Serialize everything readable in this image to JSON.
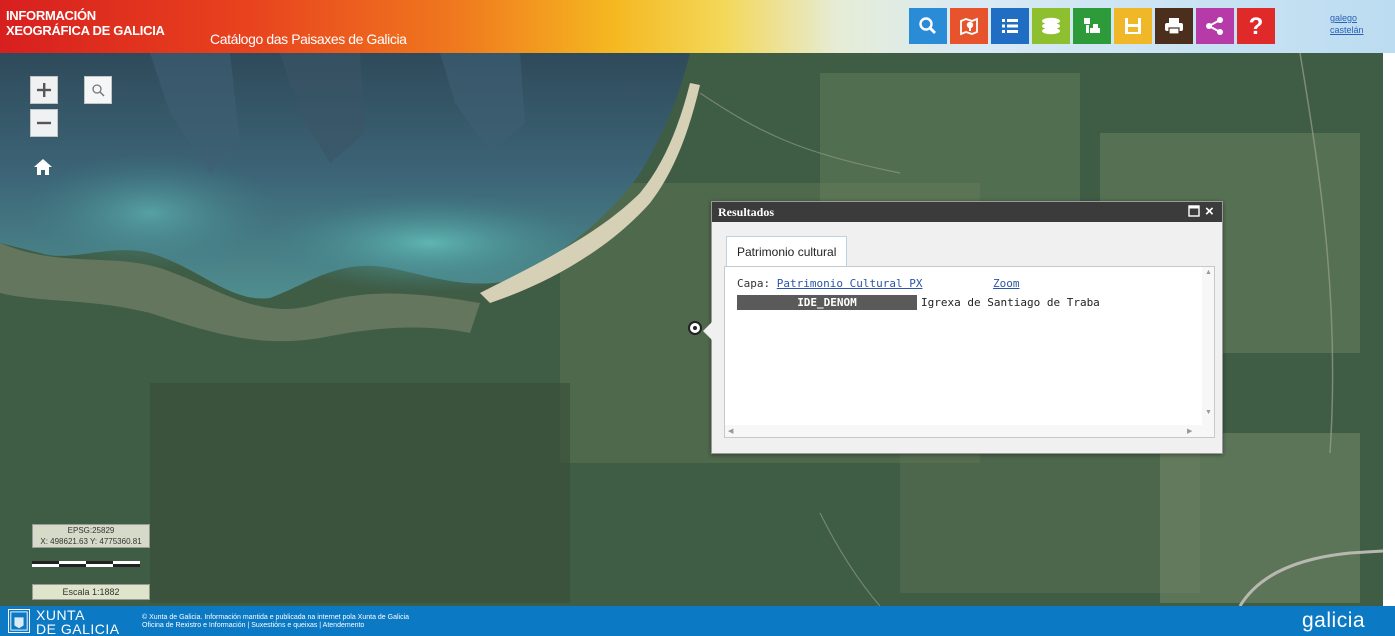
{
  "header": {
    "logo_line1": "INFORMACIÓN",
    "logo_line2": "XEOGRÁFICA DE GALICIA",
    "catalog_title": "Catálogo das Paisaxes de Galicia",
    "toolbar": [
      {
        "icon": "search-icon",
        "color": "#2a8bd6"
      },
      {
        "icon": "location-tool-icon",
        "color": "#e6532d"
      },
      {
        "icon": "list-icon",
        "color": "#1f6ec4"
      },
      {
        "icon": "layers-icon",
        "color": "#8dbf2f"
      },
      {
        "icon": "map-tools-icon",
        "color": "#2d9b3a"
      },
      {
        "icon": "save-icon",
        "color": "#f0b828"
      },
      {
        "icon": "print-icon",
        "color": "#4b2e1b"
      },
      {
        "icon": "share-icon",
        "color": "#b63aa8"
      },
      {
        "icon": "help-icon",
        "color": "#e02a2a"
      }
    ],
    "lang_links": [
      "galego",
      "castelán"
    ]
  },
  "map": {
    "coords_line1": "EPSG:25829",
    "coords_line2": "X: 498621.63  Y: 4775360.81",
    "scale_text": "Escala 1:1882"
  },
  "results": {
    "title": "Resultados",
    "tab_label": "Patrimonio cultural",
    "capa_label": "Capa:",
    "capa_link": "Patrimonio Cultural PX",
    "zoom_link": "Zoom",
    "attribute_key": "IDE_DENOM",
    "attribute_value": "Igrexa de Santiago de Traba"
  },
  "footer": {
    "xunta_line1": "XUNTA",
    "xunta_line2": "DE GALICIA",
    "footer_line1": "© Xunta de Galicia. Información mantida e publicada na internet pola Xunta de Galicia",
    "footer_line2": "Oficina de Rexistro e Información | Suxestións e queixas | Atendemento",
    "galicia_logo": "galicia"
  },
  "colors": {
    "footer": "#0b79c4",
    "titlebar": "#3b3b3b",
    "link": "#2a56a8"
  }
}
